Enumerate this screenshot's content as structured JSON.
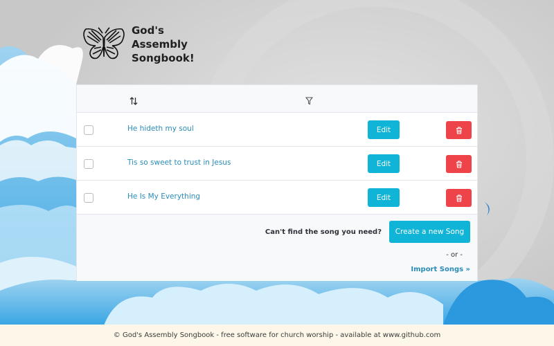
{
  "app": {
    "title_line1": "God's Assembly",
    "title_line2": "Songbook!"
  },
  "table": {
    "rows": [
      {
        "title": "He hideth my soul",
        "edit_label": "Edit"
      },
      {
        "title": "Tis so sweet to trust in Jesus",
        "edit_label": "Edit"
      },
      {
        "title": "He Is My Everything",
        "edit_label": "Edit"
      }
    ]
  },
  "actions": {
    "cant_find": "Can't find the song you need?",
    "create_label": "Create a new Song",
    "or_text": "- or -",
    "import_label": "Import Songs »"
  },
  "footer": {
    "text": "© God's Assembly Songbook - free software for church worship - available at www.github.com"
  },
  "colors": {
    "accent": "#0fb4d6",
    "danger": "#ee4348",
    "link": "#2a8bb5",
    "footer_bg": "#fcf7e8"
  },
  "icons": [
    "butterfly-logo",
    "sort-icon",
    "filter-icon",
    "trash-icon"
  ]
}
